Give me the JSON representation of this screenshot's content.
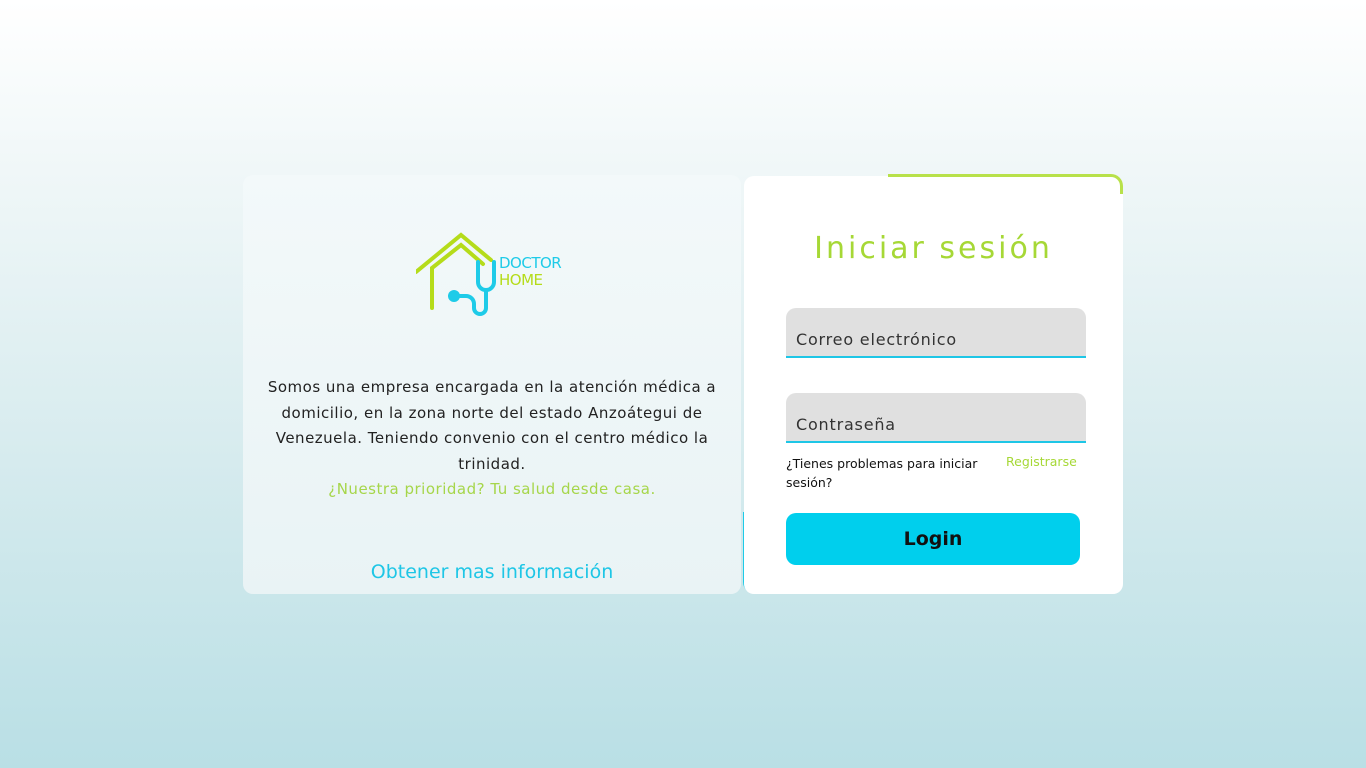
{
  "brand": {
    "line1": "DOCTOR",
    "line2": "HOME",
    "colors": {
      "green": "#a6d836",
      "cyan": "#1ec6e6"
    }
  },
  "info": {
    "description": "Somos una empresa encargada en la atención médica a domicilio, en la zona norte del estado Anzoátegui de Venezuela. Teniendo convenio con el centro médico la trinidad.",
    "tagline": "¿Nuestra prioridad? Tu salud desde casa.",
    "more_link": "Obtener mas información"
  },
  "login": {
    "title": "Iniciar sesión",
    "email_placeholder": "Correo electrónico",
    "password_placeholder": "Contraseña",
    "help_text": "¿Tienes problemas para iniciar sesión?",
    "register_link": "Registrarse",
    "submit": "Login"
  }
}
